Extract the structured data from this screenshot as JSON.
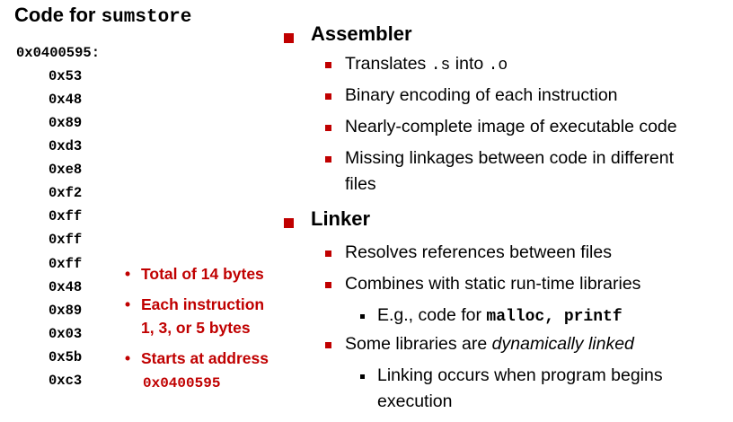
{
  "left": {
    "title_prefix": "Code for ",
    "title_code": "sumstore",
    "address": "0x0400595:",
    "bytes": [
      "0x53",
      "0x48",
      "0x89",
      "0xd3",
      "0xe8",
      "0xf2",
      "0xff",
      "0xff",
      "0xff",
      "0x48",
      "0x89",
      "0x03",
      "0x5b",
      "0xc3"
    ],
    "notes": {
      "total": "Total of 14 bytes",
      "each_line1": "Each instruction",
      "each_line2": "1, 3, or 5 bytes",
      "starts": "Starts at address",
      "start_addr": "0x0400595"
    }
  },
  "right": {
    "assembler": {
      "heading": "Assembler",
      "b1_pre": "Translates ",
      "b1_code1": ".s",
      "b1_mid": " into ",
      "b1_code2": ".o",
      "b2": "Binary encoding of each instruction",
      "b3": "Nearly-complete image of executable code",
      "b4_line1": "Missing linkages between code in different",
      "b4_line2": "files"
    },
    "linker": {
      "heading": "Linker",
      "b1": "Resolves references between files",
      "b2": "Combines with static run-time libraries",
      "sub1_pre": "E.g., code for ",
      "sub1_code": "malloc, printf",
      "b3_pre": "Some libraries are ",
      "b3_it": "dynamically linked",
      "sub2_line1": "Linking occurs when program begins",
      "sub2_line2": "execution"
    }
  },
  "colors": {
    "accent": "#c00000",
    "text": "#000000",
    "background": "#ffffff"
  }
}
